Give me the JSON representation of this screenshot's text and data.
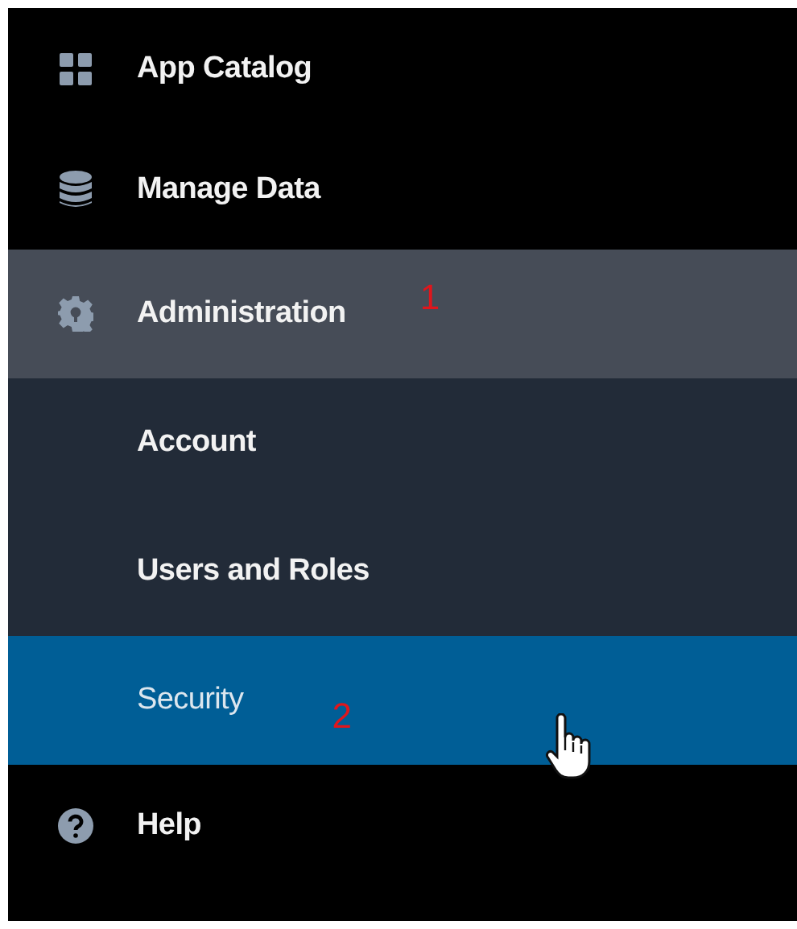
{
  "menu": [
    {
      "label": "App Catalog",
      "kind": "catalog",
      "selected": false,
      "expanded": false
    },
    {
      "label": "Manage Data",
      "kind": "data",
      "selected": false,
      "expanded": false
    },
    {
      "label": "Administration",
      "kind": "admin",
      "selected": false,
      "expanded": true,
      "annotation": "1",
      "children": [
        {
          "label": "Account",
          "selected": false
        },
        {
          "label": "Users and Roles",
          "selected": false
        },
        {
          "label": "Security",
          "selected": true,
          "annotation": "2"
        }
      ]
    },
    {
      "label": "Help",
      "kind": "help",
      "selected": false,
      "expanded": false
    }
  ]
}
